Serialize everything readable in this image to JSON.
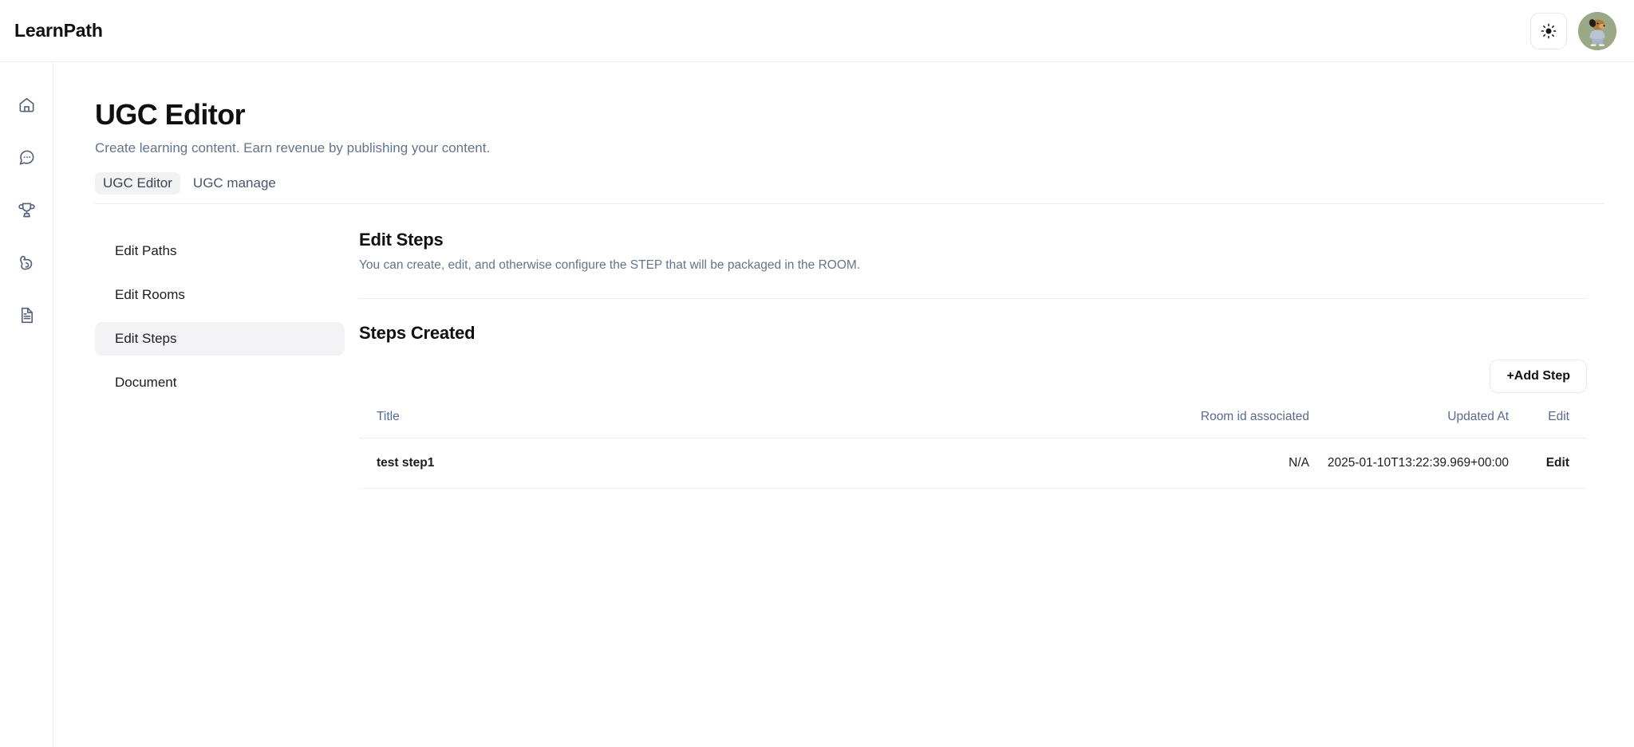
{
  "topbar": {
    "brand": "LearnPath",
    "theme_toggle_icon": "sun-icon",
    "avatar_icon": "user-avatar-dog"
  },
  "rail": {
    "items": [
      {
        "icon": "home-icon",
        "name": "home"
      },
      {
        "icon": "chat-bubble-icon",
        "name": "messages"
      },
      {
        "icon": "trophy-icon",
        "name": "achievements"
      },
      {
        "icon": "muscle-icon",
        "name": "training"
      },
      {
        "icon": "document-icon",
        "name": "documents"
      }
    ]
  },
  "page": {
    "title": "UGC Editor",
    "subtitle": "Create learning content. Earn revenue by publishing your content."
  },
  "tabs": [
    {
      "label": "UGC Editor",
      "active": true
    },
    {
      "label": "UGC manage",
      "active": false
    }
  ],
  "side_nav": [
    {
      "label": "Edit Paths",
      "active": false
    },
    {
      "label": "Edit Rooms",
      "active": false
    },
    {
      "label": "Edit Steps",
      "active": true
    },
    {
      "label": "Document",
      "active": false
    }
  ],
  "section": {
    "title": "Edit Steps",
    "description": "You can create, edit, and otherwise configure the STEP that will be packaged in the ROOM."
  },
  "steps_created": {
    "title": "Steps Created",
    "add_button": "+Add Step",
    "columns": {
      "title": "Title",
      "room": "Room id associated",
      "updated": "Updated At",
      "edit": "Edit"
    },
    "rows": [
      {
        "title": "test step1",
        "room": "N/A",
        "updated": "2025-01-10T13:22:39.969+00:00",
        "edit": "Edit"
      }
    ]
  },
  "colors": {
    "text_primary": "#101014",
    "text_muted": "#64748b",
    "rail_icon": "#55607a",
    "border": "#eceaf3",
    "active_bg": "#f3f3f5",
    "avatar_bg": "#9aa888"
  }
}
